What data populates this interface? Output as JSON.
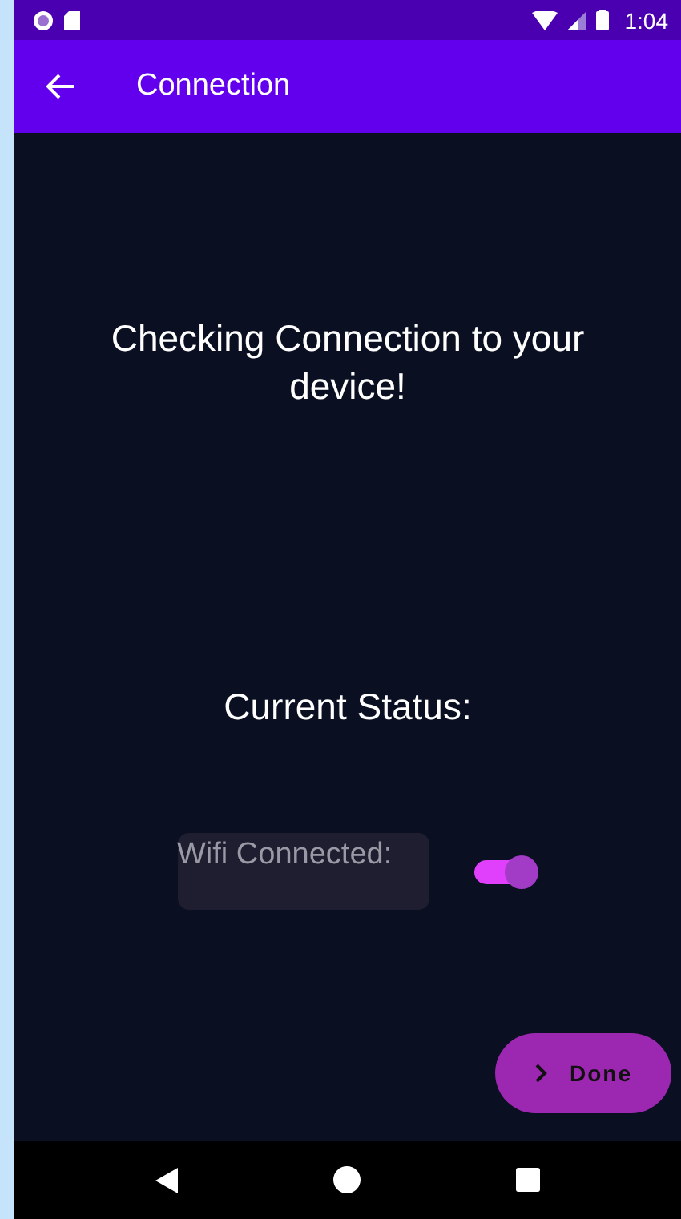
{
  "status_bar": {
    "time": "1:04"
  },
  "app_bar": {
    "title": "Connection"
  },
  "heading": "Checking Connection to your device!",
  "status_label": "Current Status:",
  "wifi": {
    "label": "Wifi Connected:",
    "on": true
  },
  "done_button": {
    "label": "Done"
  }
}
